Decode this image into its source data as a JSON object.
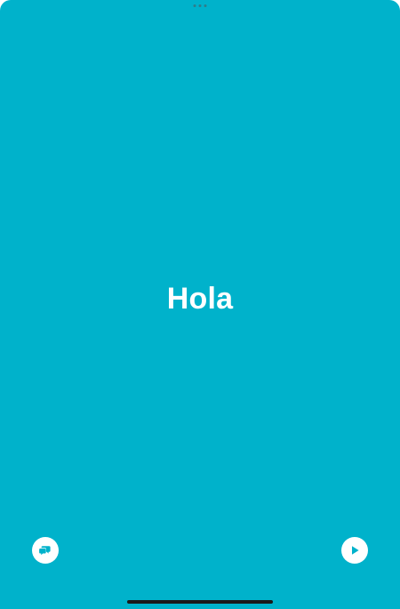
{
  "card": {
    "word": "Hola",
    "background_color": "#00b2cb",
    "foreground_color": "#ffffff"
  },
  "controls": {
    "left_icon": "speech-bubbles-icon",
    "right_icon": "play-icon"
  }
}
